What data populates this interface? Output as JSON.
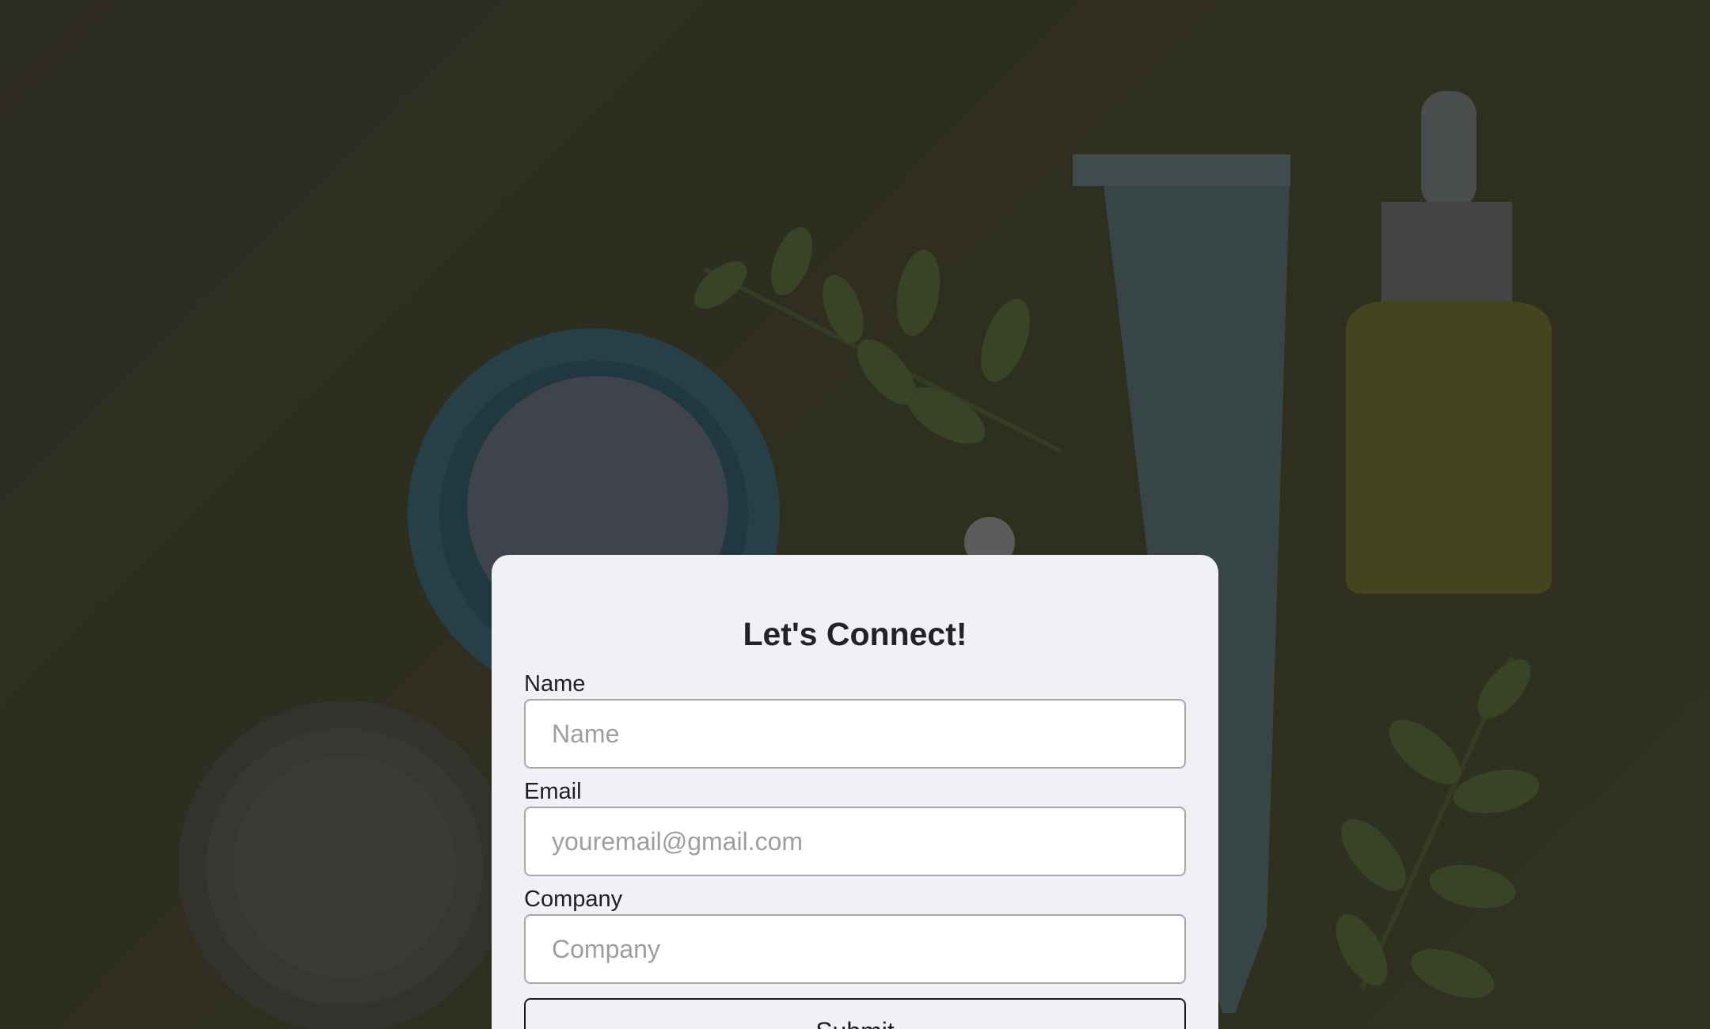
{
  "form": {
    "title": "Let's Connect!",
    "fields": [
      {
        "label": "Name",
        "placeholder": "Name",
        "value": ""
      },
      {
        "label": "Email",
        "placeholder": "youremail@gmail.com",
        "value": ""
      },
      {
        "label": "Company",
        "placeholder": "Company",
        "value": ""
      }
    ],
    "submit_label": "Submit"
  },
  "colors": {
    "card_background": "#f0f1f4",
    "title_text": "#232326",
    "input_border": "#a7a8ad",
    "placeholder_text": "#9d9ea3",
    "overlay_tint": "#2d2c28"
  }
}
